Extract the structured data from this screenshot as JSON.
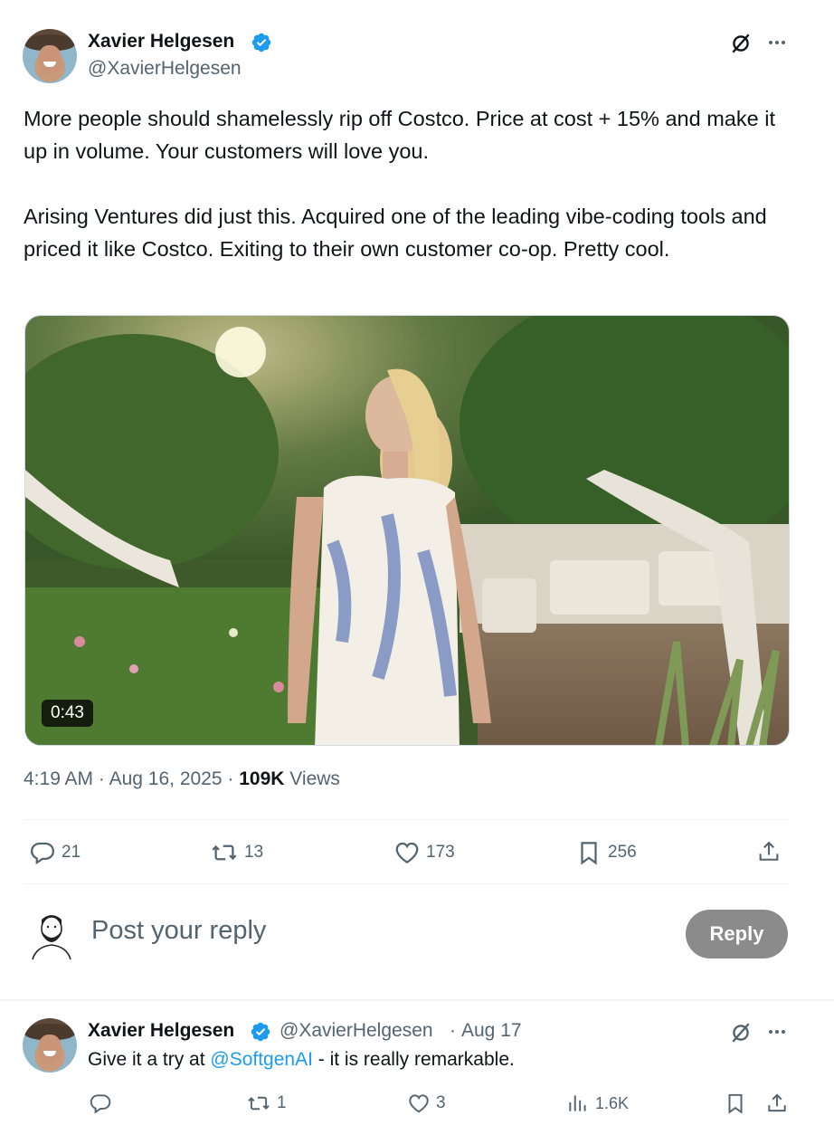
{
  "tweet": {
    "author_name": "Xavier Helgesen",
    "author_handle": "@XavierHelgesen",
    "text_p1": "More people should shamelessly rip off Costco. Price at cost + 15% and make it up in volume. Your customers will love you.",
    "text_p2": "Arising Ventures did just this. Acquired one of the leading vibe-coding tools and priced it like Costco. Exiting to their own customer co-op. Pretty cool.",
    "video_duration": "0:43",
    "time": "4:19 AM",
    "date": "Aug 16, 2025",
    "views_count": "109K",
    "views_label": "Views",
    "separator": "·",
    "replies": "21",
    "reposts": "13",
    "likes": "173",
    "bookmarks": "256"
  },
  "composer": {
    "placeholder": "Post your reply",
    "button_label": "Reply"
  },
  "reply": {
    "author_name": "Xavier Helgesen",
    "author_handle": "@XavierHelgesen",
    "date": "Aug 17",
    "text_before": "Give it a try at ",
    "mention": "@SoftgenAI",
    "text_after": " - it is really remarkable.",
    "replies": "",
    "reposts": "1",
    "likes": "3",
    "views": "1.6K"
  },
  "colors": {
    "accent": "#1d9bf0",
    "text_primary": "#0f1419",
    "text_secondary": "#536471",
    "reply_button_disabled": "#8b8b8b"
  },
  "icons": [
    "verified-badge-icon",
    "grok-icon",
    "more-icon",
    "reply-icon",
    "repost-icon",
    "like-icon",
    "bookmark-icon",
    "share-icon",
    "views-icon"
  ]
}
